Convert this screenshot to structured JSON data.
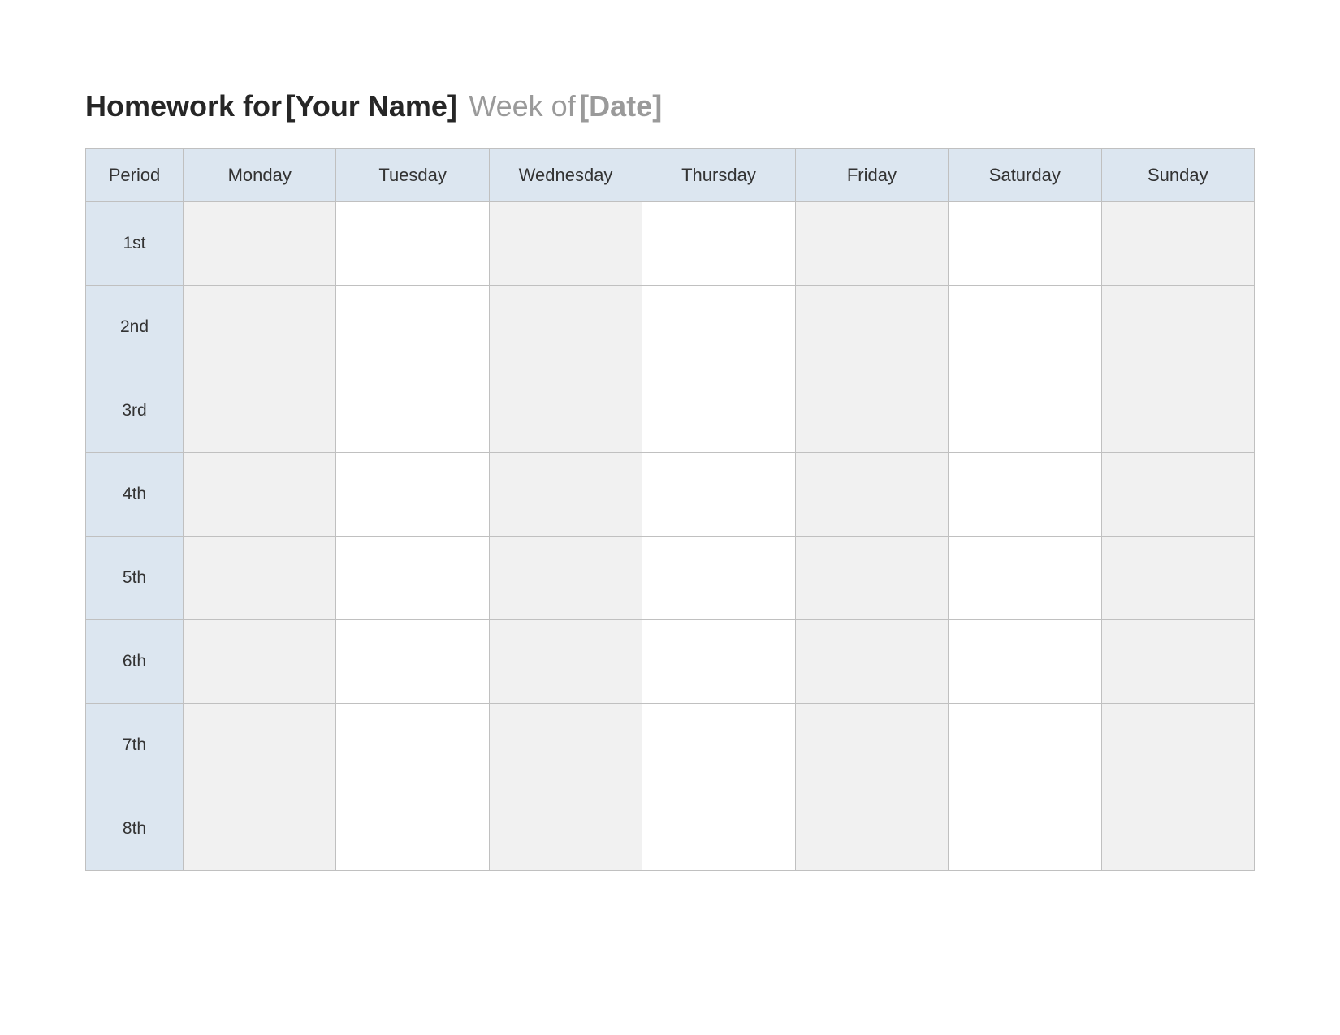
{
  "title": {
    "prefix": "Homework for",
    "name_placeholder": "[Your Name]",
    "week_label": "Week of",
    "date_placeholder": "[Date]"
  },
  "columns": {
    "period": "Period",
    "days": [
      "Monday",
      "Tuesday",
      "Wednesday",
      "Thursday",
      "Friday",
      "Saturday",
      "Sunday"
    ]
  },
  "periods": [
    "1st",
    "2nd",
    "3rd",
    "4th",
    "5th",
    "6th",
    "7th",
    "8th"
  ]
}
